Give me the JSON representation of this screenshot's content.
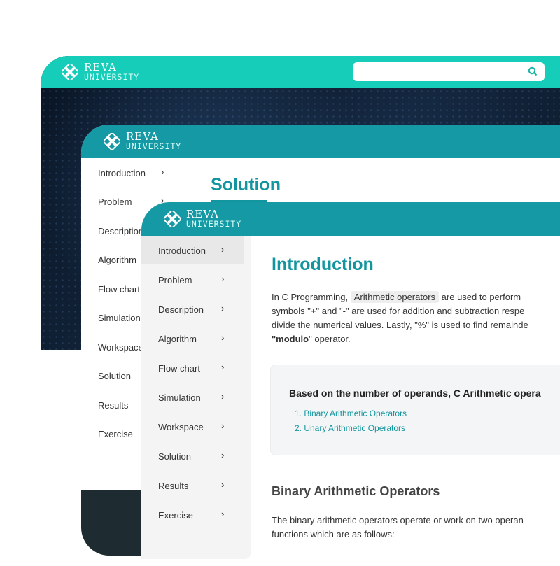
{
  "brand": {
    "name": "REVA",
    "sub": "UNIVERSITY"
  },
  "colors": {
    "teal_bright": "#15cdb8",
    "teal": "#1599a4",
    "title": "#13959f"
  },
  "back": {
    "search": {
      "placeholder": "",
      "icon": "search-icon"
    }
  },
  "middle": {
    "title": "Solution",
    "menu": [
      "Introduction",
      "Problem",
      "Description",
      "Algorithm",
      "Flow chart",
      "Simulation",
      "Workspace",
      "Solution",
      "Results",
      "Exercise"
    ],
    "chevron": "›"
  },
  "front": {
    "title": "Introduction",
    "chevron": "›",
    "menu": [
      "Introduction",
      "Problem",
      "Description",
      "Algorithm",
      "Flow chart",
      "Simulation",
      "Workspace",
      "Solution",
      "Results",
      "Exercise"
    ],
    "paragraph": {
      "l1_a": "In C Programming,",
      "l1_hl": "Arithmetic operators",
      "l1_b": "are used to perform",
      "l2": "symbols \"+\" and \"-\" are used for addition and subtraction respe",
      "l3": "divide the numerical values. Lastly, \"%\" is used to find remainde",
      "l4_bold": "\"modulo",
      "l4_rest": "\" operator."
    },
    "card": {
      "title": "Based on the number of operands, C Arithmetic opera",
      "items": [
        "1. Binary Arithmetic Operators",
        "2. Unary Arithmetic Operators"
      ]
    },
    "section": {
      "title": "Binary Arithmetic Operators",
      "l1": "The binary arithmetic operators operate or work on two operan",
      "l2": "functions which are as follows:"
    }
  }
}
